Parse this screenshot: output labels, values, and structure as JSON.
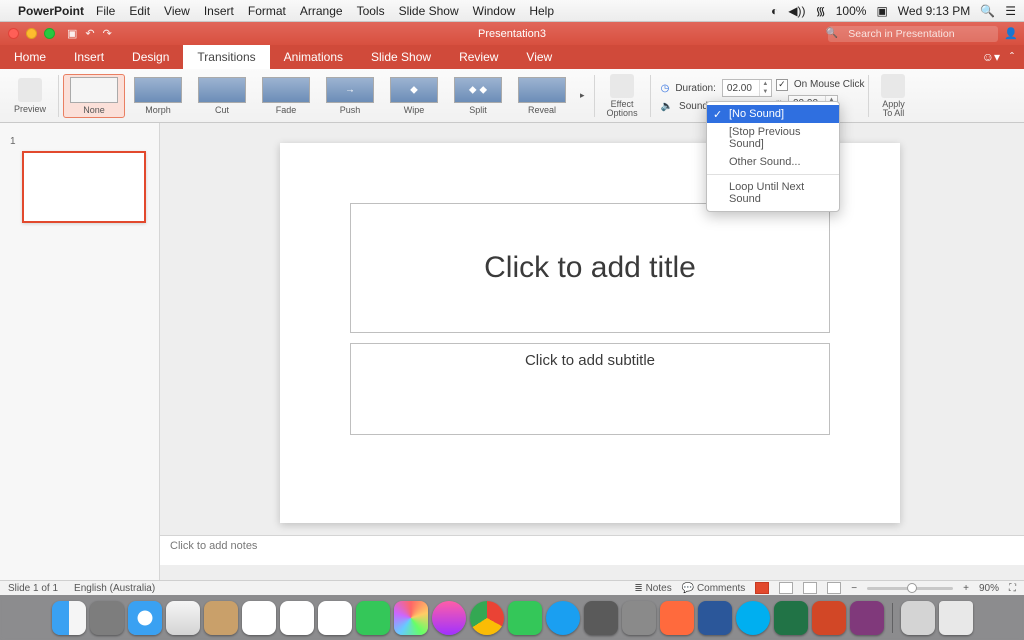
{
  "menubar": {
    "app": "PowerPoint",
    "items": [
      "File",
      "Edit",
      "View",
      "Insert",
      "Format",
      "Arrange",
      "Tools",
      "Slide Show",
      "Window",
      "Help"
    ],
    "battery": "100%",
    "clock": "Wed 9:13 PM"
  },
  "window": {
    "doc": "Presentation3",
    "search_placeholder": "Search in Presentation"
  },
  "tabs": [
    "Home",
    "Insert",
    "Design",
    "Transitions",
    "Animations",
    "Slide Show",
    "Review",
    "View"
  ],
  "ribbon": {
    "preview": "Preview",
    "transitions": [
      {
        "label": "None"
      },
      {
        "label": "Morph"
      },
      {
        "label": "Cut"
      },
      {
        "label": "Fade"
      },
      {
        "label": "Push"
      },
      {
        "label": "Wipe"
      },
      {
        "label": "Split"
      },
      {
        "label": "Reveal"
      }
    ],
    "effect_options": "Effect\nOptions",
    "duration_label": "Duration:",
    "duration_value": "02.00",
    "sound_label": "Sound:",
    "on_mouse": "On Mouse Click",
    "after_value": "00.00",
    "apply_all": "Apply\nTo All"
  },
  "sound_menu": {
    "items": [
      "[No Sound]",
      "[Stop Previous Sound]",
      "Other Sound..."
    ],
    "loop": "Loop Until Next Sound"
  },
  "slide": {
    "title_ph": "Click to add title",
    "subtitle_ph": "Click to add subtitle"
  },
  "notes_ph": "Click to add notes",
  "status": {
    "slide": "Slide 1 of 1",
    "lang": "English (Australia)",
    "notes": "Notes",
    "comments": "Comments",
    "zoom": "90%"
  },
  "thumb": {
    "num": "1"
  }
}
